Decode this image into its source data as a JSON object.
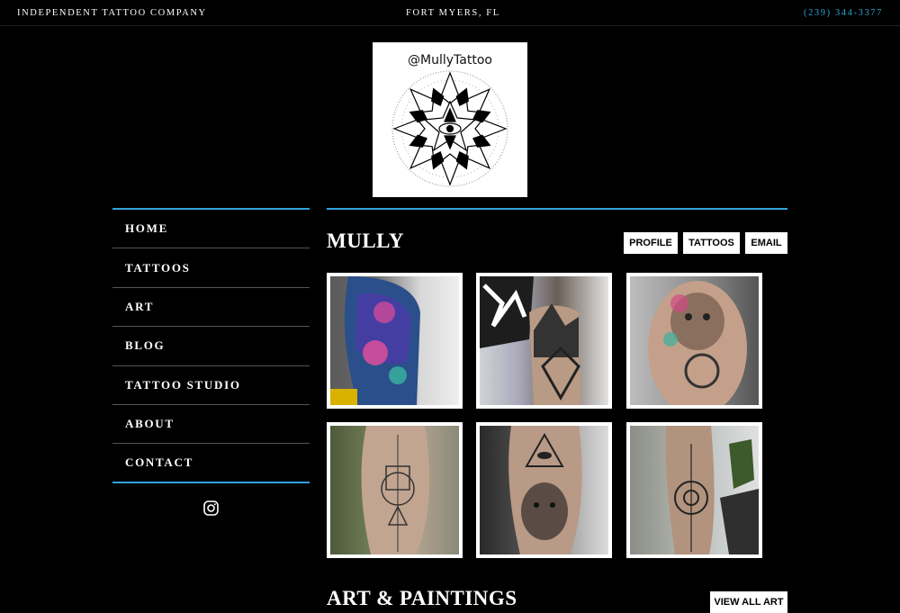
{
  "topbar": {
    "company": "INDEPENDENT TATTOO COMPANY",
    "location": "FORT MYERS, FL",
    "phone": "(239) 344-3377"
  },
  "logo": {
    "handle": "@MullyTattoo"
  },
  "nav": {
    "items": [
      {
        "label": "HOME"
      },
      {
        "label": "TATTOOS"
      },
      {
        "label": "ART"
      },
      {
        "label": "BLOG"
      },
      {
        "label": "TATTOO STUDIO"
      },
      {
        "label": "ABOUT"
      },
      {
        "label": "CONTACT"
      }
    ],
    "social_icon": "instagram-icon"
  },
  "artist": {
    "name": "MULLY",
    "buttons": {
      "profile": "PROFILE",
      "tattoos": "TATTOOS",
      "email": "EMAIL"
    }
  },
  "gallery": {
    "items": [
      {
        "subject": "cosmic floral sleeve"
      },
      {
        "subject": "mountain forest forearm"
      },
      {
        "subject": "lion with mandala thigh"
      },
      {
        "subject": "geometric fine-line forearm"
      },
      {
        "subject": "lion with eye forearm"
      },
      {
        "subject": "mandala forearm"
      }
    ]
  },
  "art_section": {
    "heading": "ART & PAINTINGS",
    "view_all": "VIEW ALL ART"
  },
  "colors": {
    "accent": "#2ea3d8",
    "background": "#000000",
    "button_bg": "#ffffff"
  }
}
